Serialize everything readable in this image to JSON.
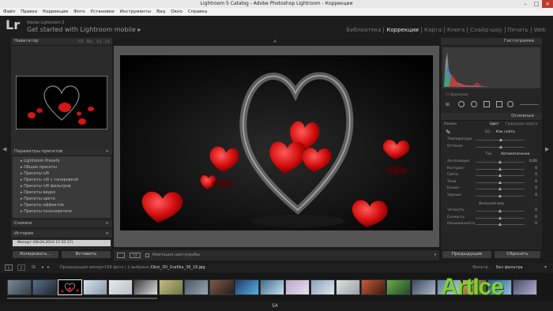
{
  "window": {
    "title": "Lightroom 5 Catalog - Adobe Photoshop Lightroom - Коррекции",
    "min": "–",
    "max": "□",
    "close": "×"
  },
  "menu": [
    "Файл",
    "Правка",
    "Коррекции",
    "Фото",
    "Установки",
    "Инструменты",
    "Вид",
    "Окно",
    "Справка"
  ],
  "identity": {
    "logo": "Lr",
    "product": "Adobe Lightroom 5",
    "tagline": "Get started with Lightroom mobile",
    "arrow": "▸"
  },
  "modules": [
    {
      "label": "Библиотека",
      "active": false
    },
    {
      "label": "Коррекции",
      "active": true
    },
    {
      "label": "Карта",
      "active": false
    },
    {
      "label": "Книга",
      "active": false
    },
    {
      "label": "Слайд-шоу",
      "active": false
    },
    {
      "label": "Печать",
      "active": false
    },
    {
      "label": "Web",
      "active": false
    }
  ],
  "left": {
    "navigator": {
      "title": "Навигатор",
      "zoom": [
        "FIT",
        "FILL",
        "1:1",
        "3:1"
      ]
    },
    "presets": {
      "title": "Параметры пресетов",
      "items": [
        "Lightroom Presets",
        "Общие пресеты",
        "Пресеты ч/б",
        "Пресеты ч/б с тонировкой",
        "Пресеты ч/б фильтров",
        "Пресеты видео",
        "Пресеты цвета",
        "Пресеты эффектов",
        "Пресеты пользователя"
      ]
    },
    "snapshots": {
      "title": "Снимки"
    },
    "history": {
      "title": "История",
      "entry": "Импорт (08.04.2014 17:35:17)"
    },
    "copy_button": "Копировать...",
    "paste_button": "Вставить"
  },
  "toolbar": {
    "soft_proof": "Имитация цветопробы"
  },
  "right": {
    "histogram": {
      "title": "Гистограмма"
    },
    "original": "Оригинал",
    "basic": {
      "title": "Основные",
      "treatment_color": "Цвет",
      "treatment_bw": "Градации серого",
      "treatment_label": "Режим",
      "wb_label": "ББ :",
      "wb_value": "Как снято",
      "temp": "Температура",
      "tint": "Оттенок",
      "tone_label": "Тон",
      "auto": "Автоматически",
      "sliders": [
        {
          "label": "Экспозиция",
          "value": "0,00",
          "pos": 0.5
        },
        {
          "label": "Контраст",
          "value": "0",
          "pos": 0.5
        },
        {
          "label": "Света",
          "value": "0",
          "pos": 0.5
        },
        {
          "label": "Тени",
          "value": "0",
          "pos": 0.5
        },
        {
          "label": "Белые",
          "value": "0",
          "pos": 0.5
        },
        {
          "label": "Черные",
          "value": "0",
          "pos": 0.5
        }
      ],
      "presence": "Внешний вид",
      "presence_sliders": [
        {
          "label": "Четкость",
          "value": "0",
          "pos": 0.5
        },
        {
          "label": "Сочность",
          "value": "0",
          "pos": 0.5
        },
        {
          "label": "Насыщенность",
          "value": "0",
          "pos": 0.5
        }
      ]
    },
    "previous_button": "Предыдущие",
    "reset_button": "Сбросить"
  },
  "filmbar": {
    "page1": "1",
    "page2": "2",
    "source": "Предыдущий импорт",
    "count": "199 фото / 1 выбрано /",
    "file": "Oboi_3D_Grafika_38_16.jpg",
    "filter_label": "Фильтр :",
    "filter_value": "Без фильтра"
  },
  "bottom": {
    "center_text": "SA",
    "watermark": "ArtIce"
  },
  "colors": {
    "accent": "#7dd23a",
    "panel": "#252525",
    "background": "#1b1b1b"
  }
}
